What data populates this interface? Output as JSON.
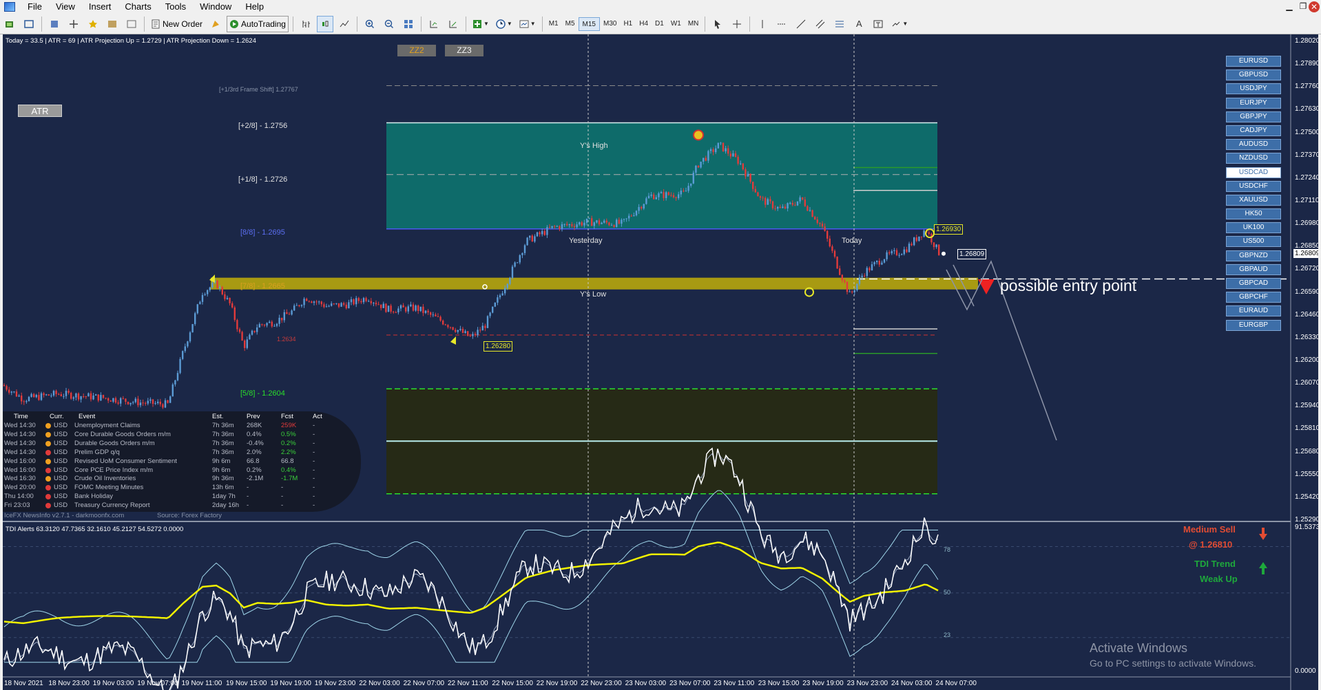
{
  "menu": {
    "items": [
      "File",
      "View",
      "Insert",
      "Charts",
      "Tools",
      "Window",
      "Help"
    ]
  },
  "window_controls": {
    "minimize": "▁",
    "restore": "❐",
    "close": "✕"
  },
  "toolbar": {
    "new_order": "New Order",
    "autotrading": "AutoTrading",
    "timeframes": [
      "M1",
      "M5",
      "M15",
      "M30",
      "H1",
      "H4",
      "D1",
      "W1",
      "MN"
    ],
    "active_timeframe": "M15"
  },
  "chart": {
    "info_line": "Today = 33.5    |    ATR = 69    |    ATR Projection Up = 1.2729    |    ATR Projection Down = 1.2624",
    "atr_button": "ATR",
    "zz2_button": "ZZ2",
    "zz3_button": "ZZ3",
    "frame_shift": "[+1/3rd Frame Shift]  1.27767",
    "levels": {
      "p28": "[+2/8] - 1.2756",
      "p18": "[+1/8] - 1.2726",
      "l88": "[8/8] - 1.2695",
      "l78": "[7/8] - 1.2665",
      "l58": "[5/8] - 1.2604",
      "mid_label": "1.2634"
    },
    "zone_labels": {
      "ys_high": "Y's High",
      "ys_low": "Y's Low",
      "yesterday": "Yesterday",
      "today": "Today"
    },
    "price_tags": {
      "high_tag": "1.26930",
      "current_tag": "1.26809",
      "low_tag": "1.26280",
      "current_axis": "1.26809"
    },
    "annotation": "possible entry point",
    "price_axis": [
      "1.28020",
      "1.27890",
      "1.27760",
      "1.27630",
      "1.27500",
      "1.27370",
      "1.27240",
      "1.27110",
      "1.26980",
      "1.26850",
      "1.26720",
      "1.26590",
      "1.26460",
      "1.26330",
      "1.26200",
      "1.26070",
      "1.25940",
      "1.25810",
      "1.25680",
      "1.25550",
      "1.25420",
      "1.25290"
    ],
    "date_axis": [
      "18 Nov 2021",
      "18 Nov 23:00",
      "19 Nov 03:00",
      "19 Nov 07:00",
      "19 Nov 11:00",
      "19 Nov 15:00",
      "19 Nov 19:00",
      "19 Nov 23:00",
      "22 Nov 03:00",
      "22 Nov 07:00",
      "22 Nov 11:00",
      "22 Nov 15:00",
      "22 Nov 19:00",
      "22 Nov 23:00",
      "23 Nov 03:00",
      "23 Nov 07:00",
      "23 Nov 11:00",
      "23 Nov 15:00",
      "23 Nov 19:00",
      "23 Nov 23:00",
      "24 Nov 03:00",
      "24 Nov 07:00"
    ],
    "symbols": [
      "EURUSD",
      "GBPUSD",
      "USDJPY",
      "EURJPY",
      "GBPJPY",
      "CADJPY",
      "AUDUSD",
      "NZDUSD",
      "USDCAD",
      "USDCHF",
      "XAUUSD",
      "HK50",
      "UK100",
      "US500",
      "GBPNZD",
      "GBPAUD",
      "GBPCAD",
      "GBPCHF",
      "EURAUD",
      "EURGBP"
    ],
    "selected_symbol": "USDCAD"
  },
  "news": {
    "headers": [
      "Time",
      "Curr.",
      "Event",
      "Est.",
      "Prev",
      "Fcst",
      "Act"
    ],
    "rows": [
      {
        "day": "Wed",
        "time": "14:30",
        "curr": "USD",
        "impact": "orange",
        "event": "Unemployment Claims",
        "est": "7h 36m",
        "prev": "268K",
        "fcst": "259K",
        "act": "-",
        "fcst_color": "red"
      },
      {
        "day": "Wed",
        "time": "14:30",
        "curr": "USD",
        "impact": "orange",
        "event": "Core Durable Goods Orders m/m",
        "est": "7h 36m",
        "prev": "0.4%",
        "fcst": "0.5%",
        "act": "-",
        "fcst_color": "green"
      },
      {
        "day": "Wed",
        "time": "14:30",
        "curr": "USD",
        "impact": "orange",
        "event": "Durable Goods Orders m/m",
        "est": "7h 36m",
        "prev": "-0.4%",
        "fcst": "0.2%",
        "act": "-",
        "fcst_color": "green"
      },
      {
        "day": "Wed",
        "time": "14:30",
        "curr": "USD",
        "impact": "red",
        "event": "Prelim GDP q/q",
        "est": "7h 36m",
        "prev": "2.0%",
        "fcst": "2.2%",
        "act": "-",
        "fcst_color": "green"
      },
      {
        "day": "Wed",
        "time": "16:00",
        "curr": "USD",
        "impact": "orange",
        "event": "Revised UoM Consumer Sentiment",
        "est": "9h 6m",
        "prev": "66.8",
        "fcst": "66.8",
        "act": "-",
        "fcst_color": "grey"
      },
      {
        "day": "Wed",
        "time": "16:00",
        "curr": "USD",
        "impact": "red",
        "event": "Core PCE Price Index m/m",
        "est": "9h 6m",
        "prev": "0.2%",
        "fcst": "0.4%",
        "act": "-",
        "fcst_color": "green"
      },
      {
        "day": "Wed",
        "time": "16:30",
        "curr": "USD",
        "impact": "orange",
        "event": "Crude Oil Inventories",
        "est": "9h 36m",
        "prev": "-2.1M",
        "fcst": "-1.7M",
        "act": "-",
        "fcst_color": "green"
      },
      {
        "day": "Wed",
        "time": "20:00",
        "curr": "USD",
        "impact": "red",
        "event": "FOMC Meeting Minutes",
        "est": "13h 6m",
        "prev": "-",
        "fcst": "-",
        "act": "-",
        "fcst_color": "grey"
      },
      {
        "day": "Thu",
        "time": "14:00",
        "curr": "USD",
        "impact": "red",
        "event": "Bank Holiday",
        "est": "1day 7h",
        "prev": "-",
        "fcst": "-",
        "act": "-",
        "fcst_color": "grey"
      },
      {
        "day": "Fri",
        "time": "23:03",
        "curr": "USD",
        "impact": "red",
        "event": "Treasury Currency Report",
        "est": "2day 16h",
        "prev": "-",
        "fcst": "-",
        "act": "-",
        "fcst_color": "grey"
      }
    ],
    "footer": "IceFX NewsInfo v2.7.1  -  darkmoonfx.com",
    "source": "Source: Forex Factory"
  },
  "tdi": {
    "header": "TDI Alerts  63.3120 47.7365 32.1610 45.2127 54.5272 0.0000",
    "level_78": "78",
    "level_50": "50",
    "level_23": "23",
    "axis_top": "91.5373",
    "axis_bottom": "0.0000",
    "signal1_line1": "Medium Sell",
    "signal1_line2": "@ 1.26810",
    "signal2_line1": "TDI Trend",
    "signal2_line2": "Weak Up"
  },
  "watermark": {
    "title": "Activate Windows",
    "subtitle": "Go to PC settings to activate Windows."
  },
  "colors": {
    "chart_bg": "#1b2747",
    "zone_teal": "#0e6b6a",
    "zone_yellow": "#a89a12",
    "sell_red": "#e24c33",
    "trend_green": "#1ea83c"
  }
}
